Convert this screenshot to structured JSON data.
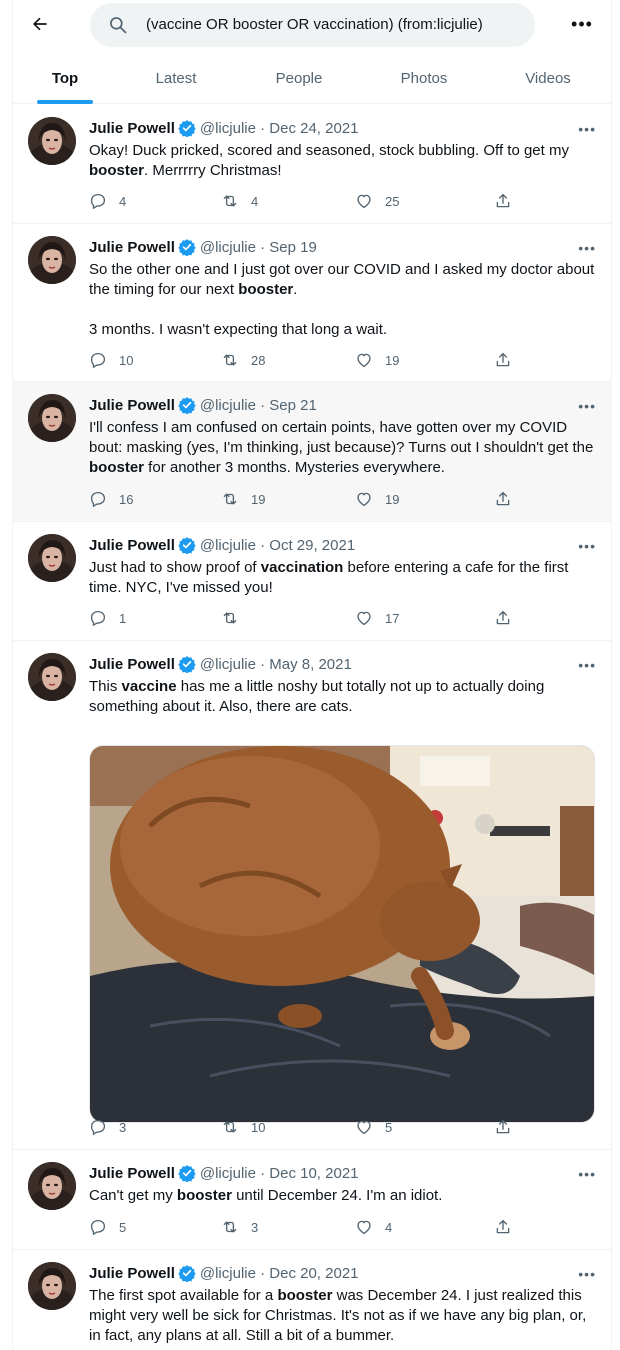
{
  "search": {
    "query": "(vaccine OR booster OR  vaccination) (from:licjulie)"
  },
  "tabs": [
    {
      "label": "Top",
      "active": true
    },
    {
      "label": "Latest"
    },
    {
      "label": "People"
    },
    {
      "label": "Photos"
    },
    {
      "label": "Videos"
    }
  ],
  "author": {
    "name": "Julie Powell",
    "handle": "@licjulie"
  },
  "colors": {
    "accent": "#1d9bf0",
    "muted": "#536471",
    "highlight_bg": "#f7f7f7"
  },
  "tweets": [
    {
      "date": "Dec 24, 2021",
      "text_parts": [
        "Okay! Duck pricked, scored and seasoned, stock bubbling. Off to get my ",
        "booster",
        ". Merrrrry Christmas!"
      ],
      "replies": "4",
      "retweets": "4",
      "likes": "25"
    },
    {
      "date": "Sep 19",
      "text_parts": [
        "So the other one and I just got over our COVID and I asked my doctor about the timing for our next ",
        "booster",
        ".\n\n3 months. I wasn't expecting that long a wait."
      ],
      "replies": "10",
      "retweets": "28",
      "likes": "19"
    },
    {
      "date": "Sep 21",
      "text_parts": [
        "I'll confess I am confused on certain points, have gotten over my COVID bout: masking (yes, I'm thinking, just because)? Turns out I shouldn't get the ",
        "booster",
        " for another 3 months. Mysteries everywhere."
      ],
      "replies": "16",
      "retweets": "19",
      "likes": "19"
    },
    {
      "date": "Oct 29, 2021",
      "text_parts": [
        "Just had to show proof of ",
        "vaccination",
        " before entering a cafe for the first time. NYC, I've missed you!"
      ],
      "replies": "1",
      "retweets": "",
      "likes": "17"
    },
    {
      "date": "May 8, 2021",
      "text_parts": [
        "This ",
        "vaccine",
        " has me a little noshy but totally not up to actually doing something about it. Also, there are cats."
      ],
      "replies": "3",
      "retweets": "10",
      "likes": "5",
      "media": "cat-photo"
    },
    {
      "date": "Dec 10, 2021",
      "text_parts": [
        "Can't get my ",
        "booster",
        " until December 24. I'm an idiot."
      ],
      "replies": "5",
      "retweets": "3",
      "likes": "4"
    },
    {
      "date": "Dec 20, 2021",
      "text_parts": [
        "The first spot available for a ",
        "booster",
        " was December 24. I just realized this might very well be sick for Christmas. It's not as if we have any big plan, or, in fact, any plans at all. Still a bit of a bummer."
      ]
    }
  ]
}
